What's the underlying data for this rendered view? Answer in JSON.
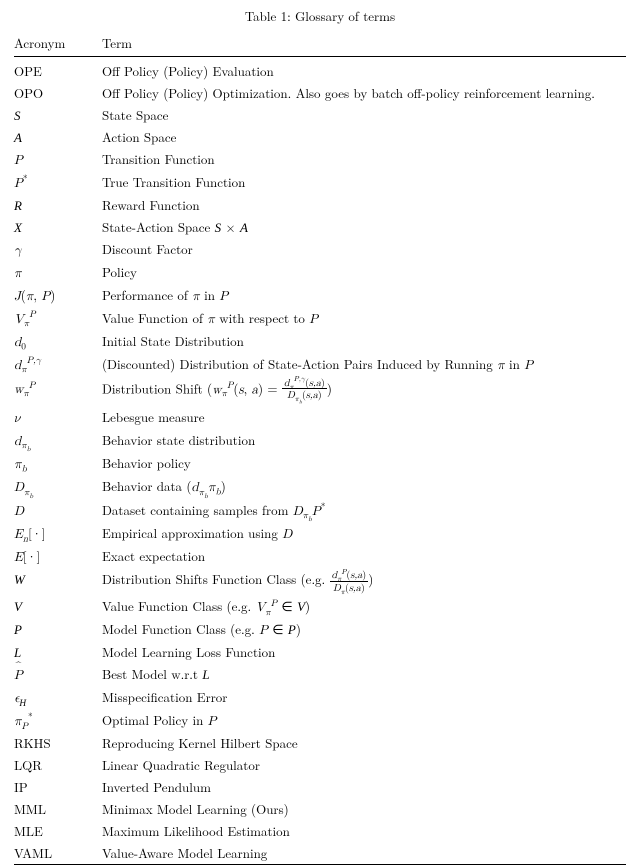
{
  "caption": "Table 1: Glossary of terms",
  "header": {
    "c1": "Acronym",
    "c2": "Term"
  },
  "rows": [
    {
      "acr_text": "OPE",
      "term_text": "Off Policy (Policy) Evaluation"
    },
    {
      "acr_text": "OPO",
      "term_text": "Off Policy (Policy) Optimization. Also goes by batch off-policy reinforcement learning."
    },
    {
      "acr_html": "<span class='cal'>S</span>",
      "term_text": "State Space"
    },
    {
      "acr_html": "<span class='cal'>A</span>",
      "term_text": "Action Space"
    },
    {
      "acr_html": "<span class='math'>P</span>",
      "term_text": "Transition Function"
    },
    {
      "acr_html": "<span class='math'>P</span><sup>*</sup>",
      "term_text": "True Transition Function"
    },
    {
      "acr_html": "<span class='cal'>R</span>",
      "term_text": "Reward Function"
    },
    {
      "acr_html": "<span class='cal'>X</span>",
      "term_html": "State-Action Space <span class='cal'>S</span> × <span class='cal'>A</span>"
    },
    {
      "acr_html": "<span class='math'>γ</span>",
      "term_text": "Discount Factor"
    },
    {
      "acr_html": "<span class='math'>π</span>",
      "term_text": "Policy"
    },
    {
      "acr_html": "<span class='math'>J</span>(<span class='math'>π</span>, <span class='math'>P</span>)",
      "term_html": "Performance of <span class='math'>π</span> in <span class='math'>P</span>"
    },
    {
      "acr_html": "<span class='math'>V</span><sub><span class='math'>π</span></sub><sup><span class='math'>P</span></sup>",
      "term_html": "Value Function of <span class='math'>π</span> with respect to <span class='math'>P</span>"
    },
    {
      "acr_html": "<span class='math'>d</span><sub>0</sub>",
      "term_text": "Initial State Distribution"
    },
    {
      "acr_html": "<span class='math'>d</span><sub><span class='math'>π</span></sub><sup><span class='math'>P,γ</span></sup>",
      "term_html": "(Discounted) Distribution of State-Action Pairs Induced by Running <span class='math'>π</span> in <span class='math'>P</span>"
    },
    {
      "acr_html": "<span class='math'>w</span><sub><span class='math'>π</span></sub><sup><span class='math'>P</span></sup>",
      "term_html": "Distribution Shift (<span class='math'>w</span><sub><span class='math'>π</span></sub><sup><span class='math'>P</span></sup>(<span class='math'>s</span>, <span class='math'>a</span>) = <span class='frac'><span class='num'><span class='math'>d</span><sub><span class='math'>π</span></sub><sup><span class='math'>P,γ</span></sup>(<span class='math'>s,a</span>)</span><span class='den'><span class='math'>D</span><sub><span class='math'>π<sub>b</sub></span></sub>(<span class='math'>s,a</span>)</span></span>)"
    },
    {
      "acr_html": "<span class='math'>ν</span>",
      "term_text": "Lebesgue measure"
    },
    {
      "acr_html": "<span class='math'>d</span><sub><span class='math'>π<sub>b</sub></span></sub>",
      "term_text": "Behavior state distribution"
    },
    {
      "acr_html": "<span class='math'>π<sub>b</sub></span>",
      "term_text": "Behavior policy"
    },
    {
      "acr_html": "<span class='math'>D</span><sub><span class='math'>π<sub>b</sub></span></sub>",
      "term_html": "Behavior data (<span class='math'>d</span><sub><span class='math'>π<sub>b</sub></span></sub><span class='math'>π<sub>b</sub></span>)"
    },
    {
      "acr_html": "<span class='math'>D</span>",
      "term_html": "Dataset containing samples from <span class='math'>D</span><sub><span class='math'>π<sub>b</sub></span></sub><span class='math'>P</span><sup>*</sup>"
    },
    {
      "acr_html": "<span class='math'>E<sub>n</sub></span>[·]",
      "term_html": "Empirical approximation using <span class='math'>D</span>"
    },
    {
      "acr_html": "<span class='math'>E</span>[·]",
      "term_text": "Exact expectation"
    },
    {
      "acr_html": "<span class='cal'>W</span>",
      "term_html": "Distribution Shifts Function Class (e.g. <span class='frac'><span class='num'><span class='math'>d</span><sub><span class='math'>π</span></sub><sup><span class='math'>P</span></sup>(<span class='math'>s,a</span>)</span><span class='den'><span class='math'>D</span><sub><span class='math'>π</span></sub>(<span class='math'>s,a</span>)</span></span>)"
    },
    {
      "acr_html": "<span class='cal'>V</span>",
      "term_html": "Value Function Class (e.g. <span class='math'>V</span><sub><span class='math'>π</span></sub><sup><span class='math'>P</span></sup> ∈ <span class='cal'>V</span>)"
    },
    {
      "acr_html": "<span class='cal'>P</span>",
      "term_html": "Model Function Class (e.g. <span class='math'>P</span> ∈ <span class='cal'>P</span>)"
    },
    {
      "acr_html": "<span class='cal'>L</span>",
      "term_text": "Model Learning Loss Function"
    },
    {
      "acr_html": "<span class='hat'><span class='math'>P</span></span>",
      "term_html": "Best Model w.r.t <span class='cal'>L</span>"
    },
    {
      "acr_html": "<span class='math'>ϵ</span><sub><span class='cal'>H</span></sub>",
      "term_text": "Misspecification Error"
    },
    {
      "acr_html": "<span class='math'>π</span><sub><span class='math'>P</span></sub><sup>*</sup>",
      "term_html": "Optimal Policy in <span class='math'>P</span>"
    },
    {
      "acr_text": "RKHS",
      "term_text": "Reproducing Kernel Hilbert Space"
    },
    {
      "acr_text": "LQR",
      "term_text": "Linear Quadratic Regulator"
    },
    {
      "acr_text": "IP",
      "term_text": "Inverted Pendulum"
    },
    {
      "acr_text": "MML",
      "term_text": "Minimax Model Learning (Ours)"
    },
    {
      "acr_text": "MLE",
      "term_text": "Maximum Likelihood Estimation"
    },
    {
      "acr_text": "VAML",
      "term_text": "Value-Aware Model Learning"
    }
  ],
  "chart_data": {
    "type": "table",
    "title": "Table 1: Glossary of terms",
    "columns": [
      "Acronym",
      "Term"
    ],
    "rows": [
      [
        "OPE",
        "Off Policy (Policy) Evaluation"
      ],
      [
        "OPO",
        "Off Policy (Policy) Optimization. Also goes by batch off-policy reinforcement learning."
      ],
      [
        "S",
        "State Space"
      ],
      [
        "A",
        "Action Space"
      ],
      [
        "P",
        "Transition Function"
      ],
      [
        "P*",
        "True Transition Function"
      ],
      [
        "R",
        "Reward Function"
      ],
      [
        "X",
        "State-Action Space S × A"
      ],
      [
        "γ",
        "Discount Factor"
      ],
      [
        "π",
        "Policy"
      ],
      [
        "J(π, P)",
        "Performance of π in P"
      ],
      [
        "V_π^P",
        "Value Function of π with respect to P"
      ],
      [
        "d_0",
        "Initial State Distribution"
      ],
      [
        "d_π^{P,γ}",
        "(Discounted) Distribution of State-Action Pairs Induced by Running π in P"
      ],
      [
        "w_π^P",
        "Distribution Shift (w_π^P(s,a) = d_π^{P,γ}(s,a) / D_{π_b}(s,a))"
      ],
      [
        "ν",
        "Lebesgue measure"
      ],
      [
        "d_{π_b}",
        "Behavior state distribution"
      ],
      [
        "π_b",
        "Behavior policy"
      ],
      [
        "D_{π_b}",
        "Behavior data (d_{π_b} π_b)"
      ],
      [
        "D",
        "Dataset containing samples from D_{π_b} P*"
      ],
      [
        "E_n[·]",
        "Empirical approximation using D"
      ],
      [
        "E[·]",
        "Exact expectation"
      ],
      [
        "W",
        "Distribution Shifts Function Class (e.g. d_π^P(s,a) / D_π(s,a))"
      ],
      [
        "V",
        "Value Function Class (e.g. V_π^P ∈ V)"
      ],
      [
        "P",
        "Model Function Class (e.g. P ∈ P)"
      ],
      [
        "L",
        "Model Learning Loss Function"
      ],
      [
        "P̂",
        "Best Model w.r.t L"
      ],
      [
        "ϵ_H",
        "Misspecification Error"
      ],
      [
        "π_P^*",
        "Optimal Policy in P"
      ],
      [
        "RKHS",
        "Reproducing Kernel Hilbert Space"
      ],
      [
        "LQR",
        "Linear Quadratic Regulator"
      ],
      [
        "IP",
        "Inverted Pendulum"
      ],
      [
        "MML",
        "Minimax Model Learning (Ours)"
      ],
      [
        "MLE",
        "Maximum Likelihood Estimation"
      ],
      [
        "VAML",
        "Value-Aware Model Learning"
      ]
    ]
  }
}
